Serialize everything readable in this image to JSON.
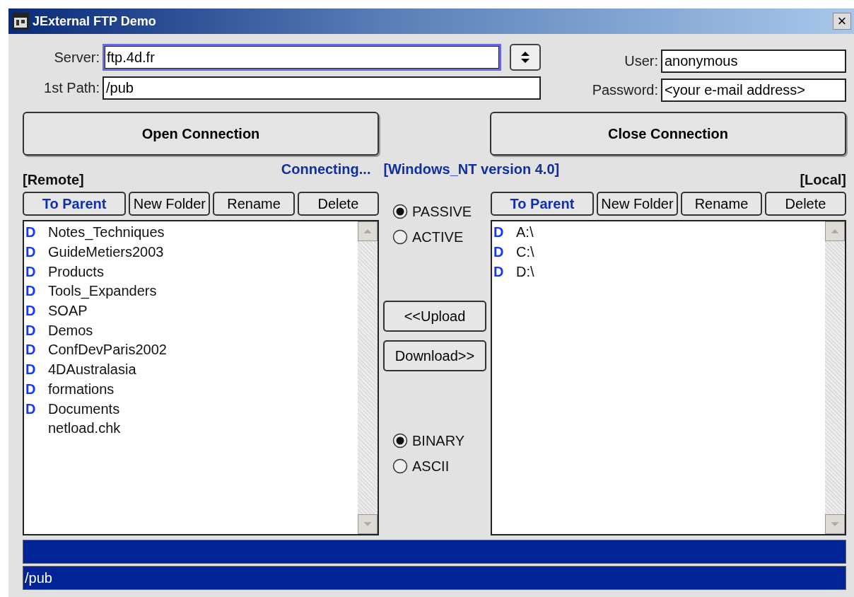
{
  "window": {
    "title": "JExternal FTP Demo",
    "close": "×"
  },
  "server": {
    "label": "Server:",
    "value": "ftp.4d.fr",
    "focused": true
  },
  "path": {
    "label": "1st Path:",
    "value": "/pub"
  },
  "user": {
    "label": "User:",
    "value": "anonymous"
  },
  "password": {
    "label": "Password:",
    "value": "<your e-mail address>"
  },
  "open_button": "Open Connection",
  "close_button": "Close Connection",
  "status": {
    "state": "Connecting...",
    "system": "[Windows_NT version 4.0]"
  },
  "remote": {
    "title": "[Remote]",
    "buttons": [
      {
        "label": "To Parent",
        "kind": "primary"
      },
      {
        "label": "New Folder",
        "kind": "plain"
      },
      {
        "label": "Rename",
        "kind": "plain"
      },
      {
        "label": "Delete",
        "kind": "plain"
      }
    ],
    "items": [
      {
        "kind": "folder",
        "marker": "D",
        "name": "Notes_Techniques"
      },
      {
        "kind": "folder",
        "marker": "D",
        "name": "GuideMetiers2003"
      },
      {
        "kind": "folder",
        "marker": "D",
        "name": "Products"
      },
      {
        "kind": "folder",
        "marker": "D",
        "name": "Tools_Expanders"
      },
      {
        "kind": "folder",
        "marker": "D",
        "name": "SOAP"
      },
      {
        "kind": "folder",
        "marker": "D",
        "name": "Demos"
      },
      {
        "kind": "folder",
        "marker": "D",
        "name": "ConfDevParis2002"
      },
      {
        "kind": "folder",
        "marker": "D",
        "name": "4DAustralasia"
      },
      {
        "kind": "folder",
        "marker": "D",
        "name": "formations"
      },
      {
        "kind": "folder",
        "marker": "D",
        "name": "Documents"
      },
      {
        "kind": "file",
        "name": "netload.chk"
      }
    ]
  },
  "local": {
    "title": "[Local]",
    "buttons": [
      {
        "label": "To Parent",
        "kind": "primary"
      },
      {
        "label": "New Folder",
        "kind": "plain"
      },
      {
        "label": "Rename",
        "kind": "plain"
      },
      {
        "label": "Delete",
        "kind": "plain"
      }
    ],
    "items": [
      {
        "kind": "folder",
        "marker": "D",
        "name": "A:\\"
      },
      {
        "kind": "folder",
        "marker": "D",
        "name": "C:\\"
      },
      {
        "kind": "folder",
        "marker": "D",
        "name": "D:\\"
      }
    ]
  },
  "mode_options": [
    {
      "label": "PASSIVE",
      "selected": true
    },
    {
      "label": "ACTIVE",
      "selected": false
    }
  ],
  "upload_button": "<<Upload",
  "download_button": "Download>>",
  "type_options": [
    {
      "label": "BINARY",
      "selected": true
    },
    {
      "label": "ASCII",
      "selected": false
    }
  ],
  "status_bar": {
    "message": "/pub"
  }
}
